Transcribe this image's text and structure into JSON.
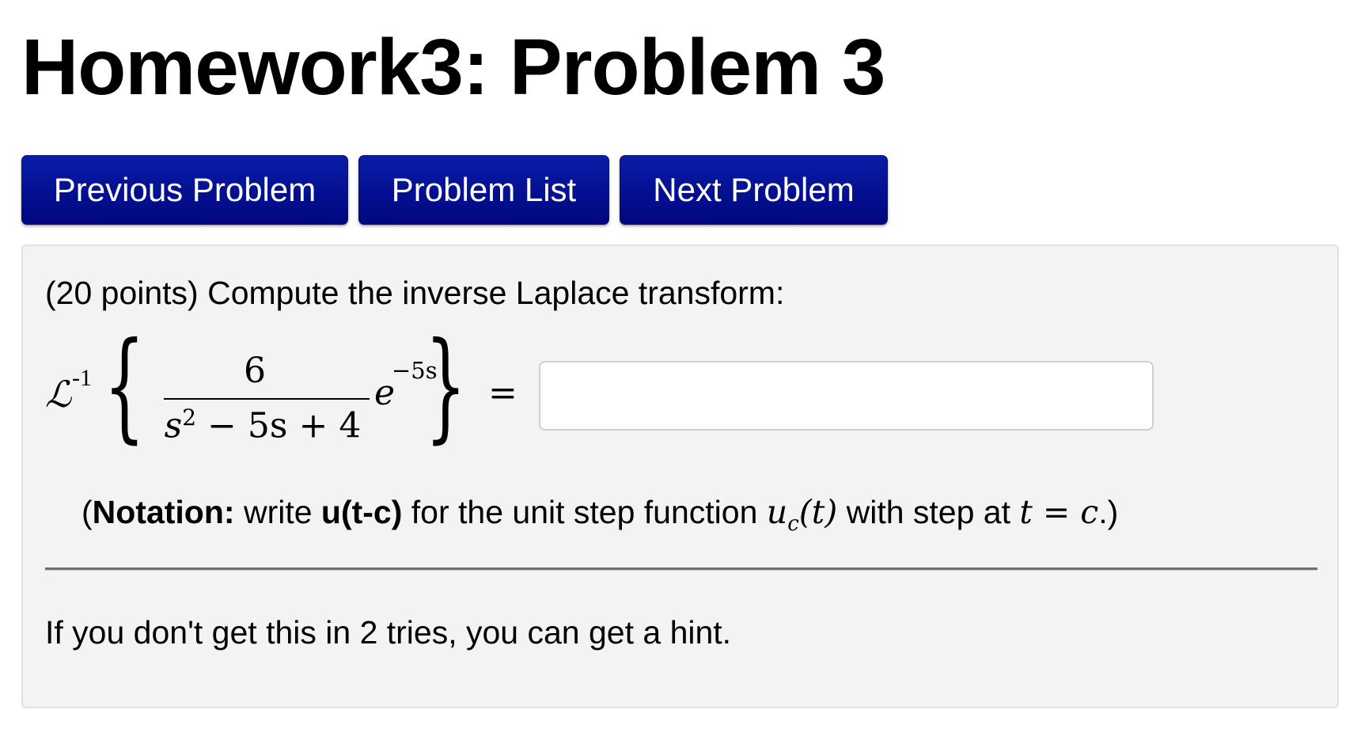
{
  "page": {
    "title": "Homework3: Problem 3"
  },
  "nav": {
    "previous_label": "Previous Problem",
    "list_label": "Problem List",
    "next_label": "Next Problem"
  },
  "problem": {
    "prompt": "(20 points) Compute the inverse Laplace transform:",
    "formula": {
      "operator": "ℒ",
      "operator_power": "-1",
      "numerator": "6",
      "denominator_s": "s",
      "denominator_s_power": "2",
      "denominator_rest": " − 5s + 4",
      "exp_base": "e",
      "exp_power": "−5s",
      "equals": "="
    },
    "answer": {
      "value": "",
      "placeholder": ""
    },
    "notation": {
      "open": "(",
      "bold_label": "Notation:",
      "text_before": " write ",
      "code": "u(t-c)",
      "text_middle": " for the unit step function ",
      "math_u": "u",
      "math_sub": "c",
      "math_arg": "(t)",
      "text_after": " with step at ",
      "math_eq": "t = c",
      "close": ".)"
    },
    "hint_text": "If you don't get this in 2 tries, you can get a hint."
  },
  "colors": {
    "button_bg": "#00077e",
    "panel_bg": "#f3f3f3"
  }
}
